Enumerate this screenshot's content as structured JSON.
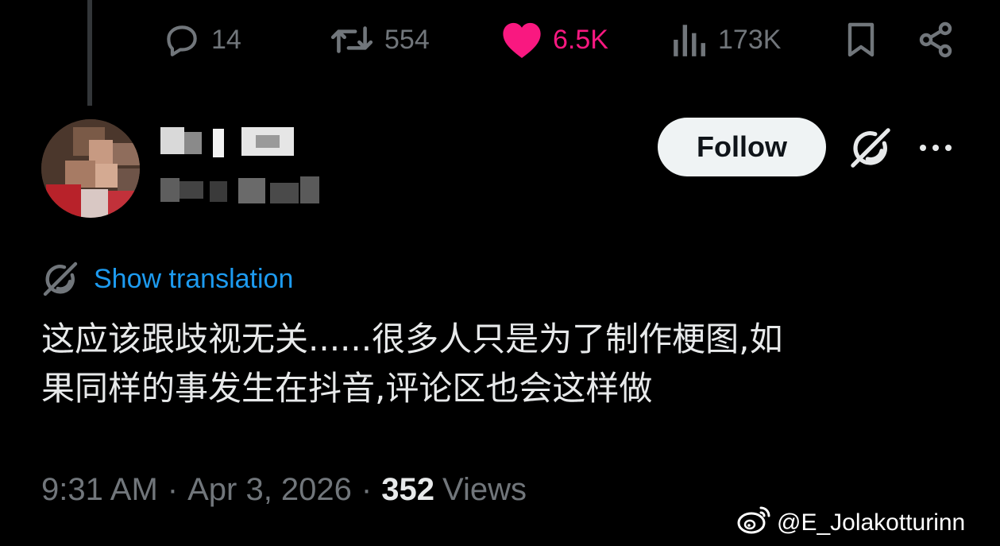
{
  "actions": {
    "replies": "14",
    "reposts": "554",
    "likes": "6.5K",
    "views": "173K"
  },
  "author": {
    "follow_label": "Follow"
  },
  "tweet": {
    "translate_label": "Show translation",
    "text": "这应该跟歧视无关......很多人只是为了制作梗图,如\n果同样的事发生在抖音,评论区也会这样做",
    "time": "9:31 AM",
    "date": "Apr 3, 2026",
    "views_count": "352",
    "views_label": "Views",
    "separator": "·"
  },
  "watermark": {
    "handle": "@E_Jolakotturinn",
    "icon": "weibo-icon"
  },
  "colors": {
    "background": "#000000",
    "text": "#e7e9ea",
    "muted": "#71767b",
    "like": "#f91880",
    "link": "#1d9bf0",
    "button_bg": "#eff3f4"
  },
  "icons": [
    "reply-icon",
    "repost-icon",
    "like-icon",
    "views-icon",
    "bookmark-icon",
    "share-icon",
    "grok-icon",
    "more-icon",
    "translate-icon"
  ]
}
